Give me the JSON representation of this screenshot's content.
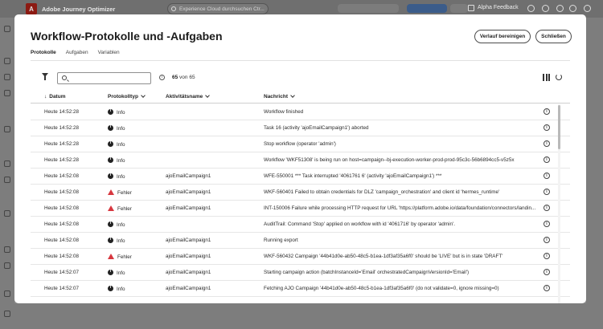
{
  "app": {
    "name": "Adobe Journey Optimizer",
    "search_placeholder": "Experience Cloud durchsuchen Ctr...",
    "alpha_feedback": "Alpha Feedback"
  },
  "modal": {
    "title": "Workflow-Protokolle und -Aufgaben",
    "buttons": {
      "clear": "Verlauf bereinigen",
      "close": "Schließen"
    },
    "tabs": [
      "Protokolle",
      "Aufgaben",
      "Variablen"
    ],
    "search_value": "",
    "count_shown": "65",
    "count_suffix": "von 65"
  },
  "table": {
    "columns": [
      "Datum",
      "Protokolltyp",
      "Aktivitätsname",
      "Nachricht"
    ],
    "rows": [
      {
        "date": "Heute 14:52:28",
        "type": "Info",
        "level": "info",
        "activity": "",
        "message": "Workflow finished"
      },
      {
        "date": "Heute 14:52:28",
        "type": "Info",
        "level": "info",
        "activity": "",
        "message": "Task 16 (activity 'ajoEmailCampaign1') aborted"
      },
      {
        "date": "Heute 14:52:28",
        "type": "Info",
        "level": "info",
        "activity": "",
        "message": "Stop workflow (operator 'admin')"
      },
      {
        "date": "Heute 14:52:28",
        "type": "Info",
        "level": "info",
        "activity": "",
        "message": "Workflow 'WKF51308' is being run on host=campaign--bj-execution-worker-prod-prod-95c3c-56b6894cc5-v5z5x"
      },
      {
        "date": "Heute 14:52:08",
        "type": "Info",
        "level": "info",
        "activity": "ajoEmailCampaign1",
        "message": "WFE-550001 *** Task interrupted '4061761 6' (activity 'ajoEmailCampaign1') ***"
      },
      {
        "date": "Heute 14:52:08",
        "type": "Fehler",
        "level": "error",
        "activity": "ajoEmailCampaign1",
        "message": "WKF-560401 Failed to obtain credentials for DLZ 'campaign_orchestration' and client id 'hermes_runtime'"
      },
      {
        "date": "Heute 14:52:08",
        "type": "Fehler",
        "level": "error",
        "activity": "ajoEmailCampaign1",
        "message": "INT-150006 Failure while processing HTTP request for URL 'https://platform.adobe.io/data/foundation/connectors/landin..."
      },
      {
        "date": "Heute 14:52:08",
        "type": "Info",
        "level": "info",
        "activity": "",
        "message": "AuditTrail: Command 'Stop' applied on workflow with id '4061716' by operator 'admin'."
      },
      {
        "date": "Heute 14:52:08",
        "type": "Info",
        "level": "info",
        "activity": "ajoEmailCampaign1",
        "message": "Running export"
      },
      {
        "date": "Heute 14:52:08",
        "type": "Fehler",
        "level": "error",
        "activity": "ajoEmailCampaign1",
        "message": "WKF-560432 Campaign '44b41d0e-ab50-48c5-b1ea-1df3af35a6f0' should be 'LIVE' but is in state 'DRAFT'"
      },
      {
        "date": "Heute 14:52:07",
        "type": "Info",
        "level": "info",
        "activity": "ajoEmailCampaign1",
        "message": "Starting campaign action (batchInstanceId='Email' orchestratedCampaignVersionId='Email')"
      },
      {
        "date": "Heute 14:52:07",
        "type": "Info",
        "level": "info",
        "activity": "ajoEmailCampaign1",
        "message": "Fetching AJO Campaign '44b41d0e-ab50-48c5-b1ea-1df3af35a6f0' (do not validate=0, ignore missing=0)"
      }
    ]
  }
}
